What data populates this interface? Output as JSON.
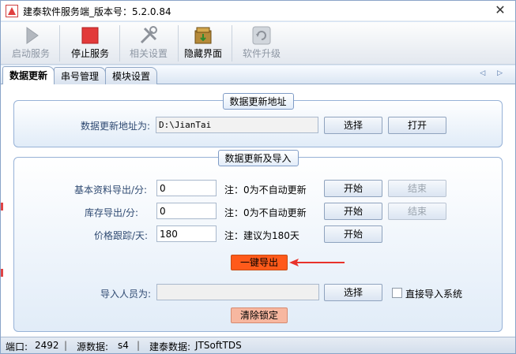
{
  "window": {
    "title": "建泰软件服务端_版本号：5.2.0.84",
    "close": "✕"
  },
  "toolbar": {
    "start": "启动服务",
    "stop": "停止服务",
    "settings": "相关设置",
    "hide": "隐藏界面",
    "upgrade": "软件升级"
  },
  "tabs": [
    "数据更新",
    "串号管理",
    "模块设置"
  ],
  "tab_nav": "◁ ▷",
  "update_address": {
    "title": "数据更新地址",
    "label": "数据更新地址为:",
    "value": "D:\\JianTai",
    "select": "选择",
    "open": "打开"
  },
  "update_import": {
    "title": "数据更新及导入",
    "rows": [
      {
        "label": "基本资料导出/分:",
        "value": "0",
        "note": "注：0为不自动更新",
        "start": "开始",
        "end": "结束"
      },
      {
        "label": "库存导出/分:",
        "value": "0",
        "note": "注：0为不自动更新",
        "start": "开始",
        "end": "结束"
      },
      {
        "label": "价格跟踪/天:",
        "value": "180",
        "note": "注：建议为180天",
        "start": "开始"
      }
    ],
    "one_click_export": "一键导出",
    "import_label": "导入人员为:",
    "import_value": "",
    "import_select": "选择",
    "direct_import": "直接导入系统",
    "clear_lock": "清除锁定"
  },
  "status": {
    "port_label": "端口:",
    "port": "2492",
    "source_label": "源数据:",
    "source": "s4",
    "jt_label": "建泰数据:",
    "jt": "JTSoftTDS"
  },
  "colors": {
    "accent": "#ff5a1a",
    "arrow": "#e8322a",
    "panel": "#e1ecf8"
  }
}
